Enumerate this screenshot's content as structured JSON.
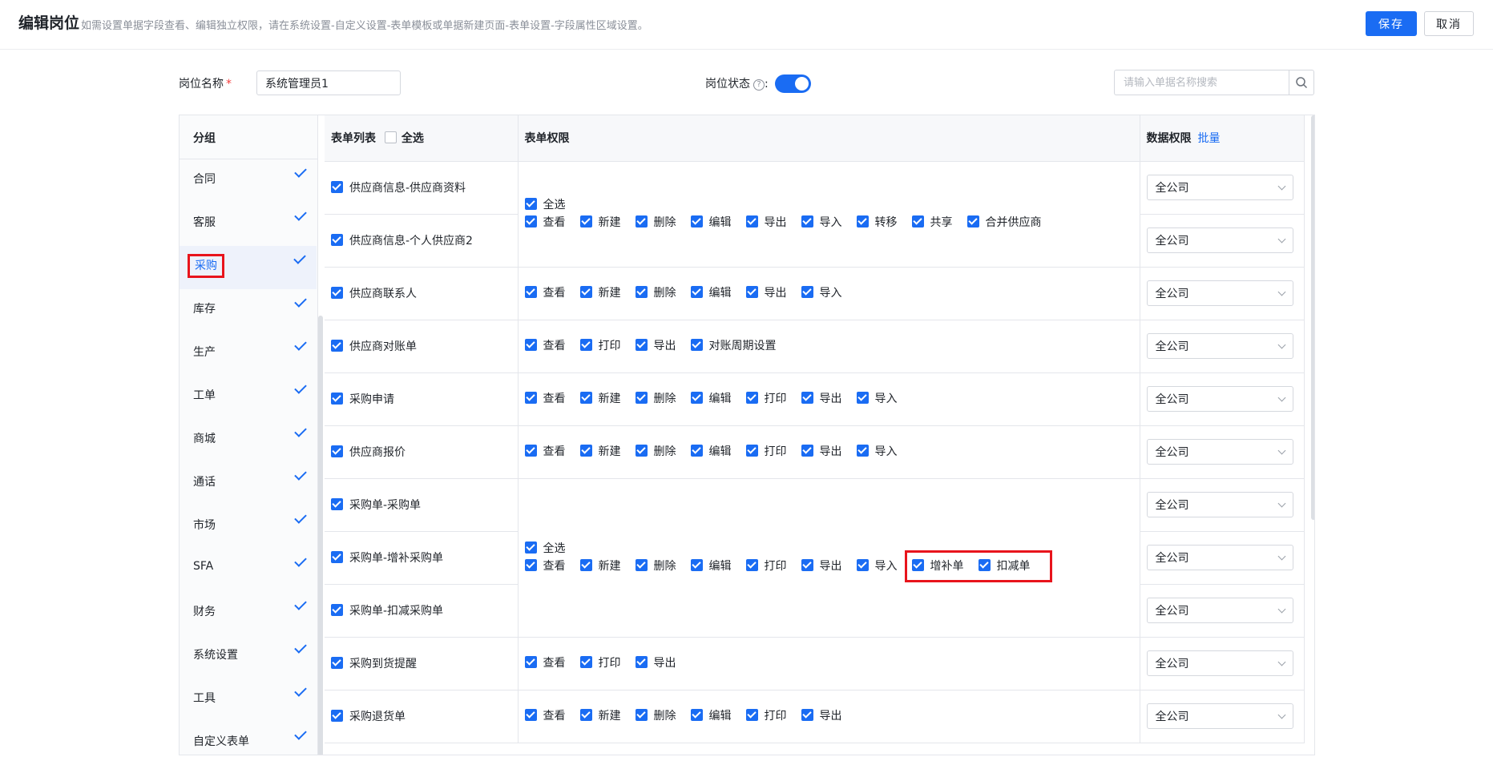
{
  "header": {
    "title": "编辑岗位",
    "hint": "如需设置单据字段查看、编辑独立权限，请在系统设置-自定义设置-表单模板或单据新建页面-表单设置-字段属性区域设置。",
    "save_label": "保存",
    "cancel_label": "取消"
  },
  "form": {
    "name_label": "岗位名称",
    "required_mark": "*",
    "name_value": "系统管理员1",
    "status_label": "岗位状态",
    "status_colon": ":",
    "status_on": true,
    "search_placeholder": "请输入单据名称搜索"
  },
  "sidebar": {
    "header": "分组",
    "items": [
      {
        "label": "合同",
        "checked": true
      },
      {
        "label": "客服",
        "checked": true
      },
      {
        "label": "采购",
        "checked": true,
        "active": true
      },
      {
        "label": "库存",
        "checked": true
      },
      {
        "label": "生产",
        "checked": true
      },
      {
        "label": "工单",
        "checked": true
      },
      {
        "label": "商城",
        "checked": true
      },
      {
        "label": "通话",
        "checked": true
      },
      {
        "label": "市场",
        "checked": true
      },
      {
        "label": "SFA",
        "checked": true
      },
      {
        "label": "财务",
        "checked": true
      },
      {
        "label": "系统设置",
        "checked": true
      },
      {
        "label": "工具",
        "checked": true
      },
      {
        "label": "自定义表单",
        "checked": true
      }
    ]
  },
  "table": {
    "col_list": "表单列表",
    "select_all": "全选",
    "col_perm": "表单权限",
    "col_data": "数据权限",
    "batch": "批量",
    "data_scope": "全公司",
    "perm_select_all": "全选",
    "rows": [
      {
        "form": "供应商信息-供应商资料"
      },
      {
        "form": "供应商信息-个人供应商2"
      },
      {
        "form": "供应商联系人"
      },
      {
        "form": "供应商对账单"
      },
      {
        "form": "采购申请"
      },
      {
        "form": "供应商报价"
      },
      {
        "form": "采购单-采购单"
      },
      {
        "form": "采购单-增补采购单"
      },
      {
        "form": "采购单-扣减采购单"
      },
      {
        "form": "采购到货提醒"
      },
      {
        "form": "采购退货单"
      }
    ],
    "perm_groups": {
      "supplier_info": [
        "查看",
        "新建",
        "删除",
        "编辑",
        "导出",
        "导入",
        "转移",
        "共享",
        "合并供应商"
      ],
      "supplier_contact": [
        "查看",
        "新建",
        "删除",
        "编辑",
        "导出",
        "导入"
      ],
      "supplier_statement": [
        "查看",
        "打印",
        "导出",
        "对账周期设置"
      ],
      "purchase_request": [
        "查看",
        "新建",
        "删除",
        "编辑",
        "打印",
        "导出",
        "导入"
      ],
      "supplier_quote": [
        "查看",
        "新建",
        "删除",
        "编辑",
        "打印",
        "导出",
        "导入"
      ],
      "purchase_order": [
        "查看",
        "新建",
        "删除",
        "编辑",
        "打印",
        "导出",
        "导入"
      ],
      "purchase_order_extra": [
        "增补单",
        "扣减单"
      ],
      "arrival_reminder": [
        "查看",
        "打印",
        "导出"
      ],
      "purchase_return": [
        "查看",
        "新建",
        "删除",
        "编辑",
        "打印",
        "导出"
      ]
    }
  },
  "colors": {
    "accent": "#1a6cf3",
    "highlight": "#e8141c"
  }
}
